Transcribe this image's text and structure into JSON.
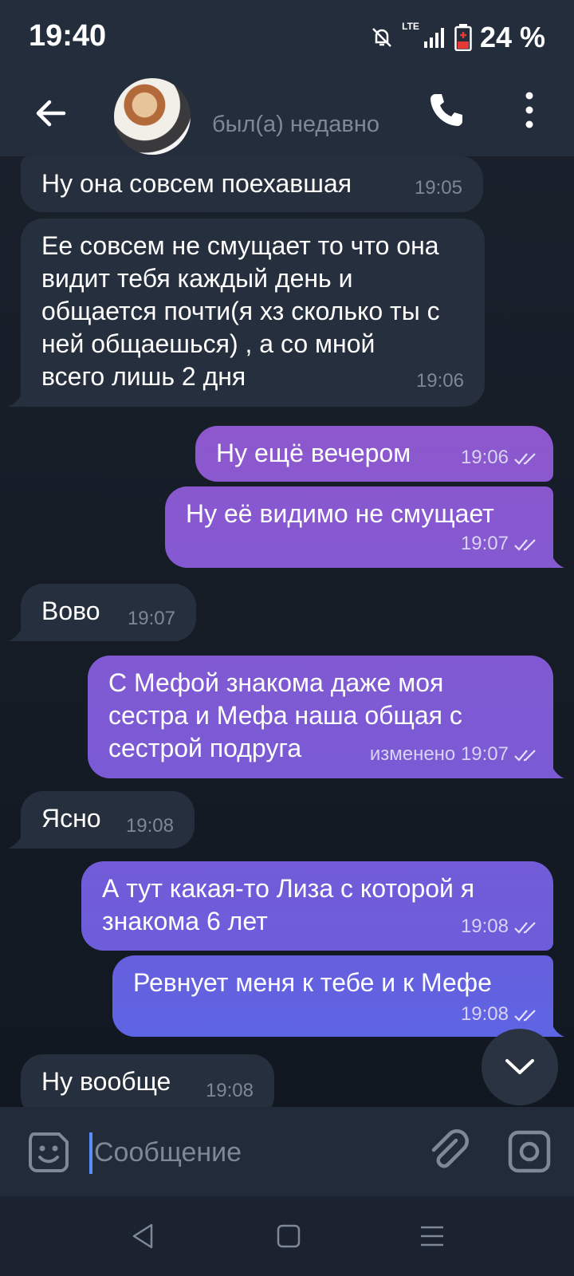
{
  "status_bar": {
    "time": "19:40",
    "network": "LTE",
    "battery": "24 %"
  },
  "header": {
    "last_seen": "был(а) недавно"
  },
  "messages": [
    {
      "dir": "in",
      "text": "Ну она совсем поехавшая",
      "time": "19:05"
    },
    {
      "dir": "in",
      "text": "Ее совсем не смущает то что она видит тебя каждый день и общается почти(я хз сколько ты с ней общаешься) , а со мной всего лишь 2 дня",
      "time": "19:06"
    },
    {
      "dir": "out",
      "text": "Ну ещё вечером",
      "time": "19:06"
    },
    {
      "dir": "out",
      "text": "Ну её видимо не смущает",
      "time": "19:07"
    },
    {
      "dir": "in",
      "text": "Вово",
      "time": "19:07"
    },
    {
      "dir": "out",
      "text": "С Мефой знакома даже моя сестра и Мефа наша общая с сестрой подруга",
      "time": "изменено 19:07"
    },
    {
      "dir": "in",
      "text": "Ясно",
      "time": "19:08"
    },
    {
      "dir": "out",
      "text": "А тут какая-то Лиза с которой я знакома 6 лет",
      "time": "19:08"
    },
    {
      "dir": "out",
      "text": "Ревнует меня к тебе и к Мефе",
      "time": "19:08"
    },
    {
      "dir": "in",
      "text": "Ну вообще",
      "time": "19:08"
    }
  ],
  "input": {
    "placeholder": "Сообщение"
  },
  "colors": {
    "outgoing_top": "#8a5ccc",
    "outgoing_bottom": "#5f67e6",
    "incoming": "#262f3d"
  }
}
